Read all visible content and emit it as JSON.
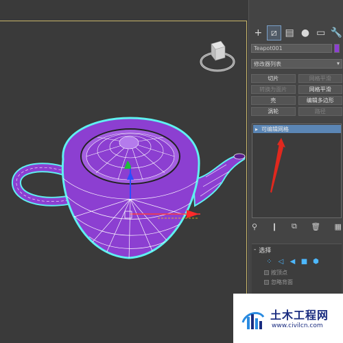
{
  "panel_tabs": [
    {
      "name": "create-tab",
      "glyph": "+"
    },
    {
      "name": "modify-tab",
      "glyph": "⧄"
    },
    {
      "name": "hierarchy-tab",
      "glyph": "▤"
    },
    {
      "name": "motion-tab",
      "glyph": "●"
    },
    {
      "name": "display-tab",
      "glyph": "▭"
    },
    {
      "name": "utilities-tab",
      "glyph": "🔧"
    }
  ],
  "object": {
    "name": "Teapot001",
    "color": "#8c3fd1"
  },
  "modifier_list": {
    "label": "修改器列表",
    "arrow": "▾"
  },
  "quick_buttons": [
    {
      "label": "切片",
      "dim": false
    },
    {
      "label": "网格平滑",
      "dim": true
    },
    {
      "label": "转换为面片",
      "dim": true
    },
    {
      "label": "网格平滑",
      "dim": false
    },
    {
      "label": "壳",
      "dim": false
    },
    {
      "label": "编辑多边形",
      "dim": false
    },
    {
      "label": "涡轮",
      "dim": false
    },
    {
      "label": "路径",
      "dim": true
    }
  ],
  "stack": {
    "expand": "▸",
    "item_label": "可编辑网格"
  },
  "selection_rollout": {
    "toggle": "-",
    "title": "选择",
    "options": [
      "按顶点",
      "忽略背面"
    ]
  },
  "watermark": {
    "title": "土木工程网",
    "url": "www.civilcn.com"
  },
  "colors": {
    "teapot": "#8c3fd1",
    "selection_outline": "#5ff0f0",
    "stack_highlight": "#5b86b5",
    "annotation_arrow": "#e0281e"
  }
}
